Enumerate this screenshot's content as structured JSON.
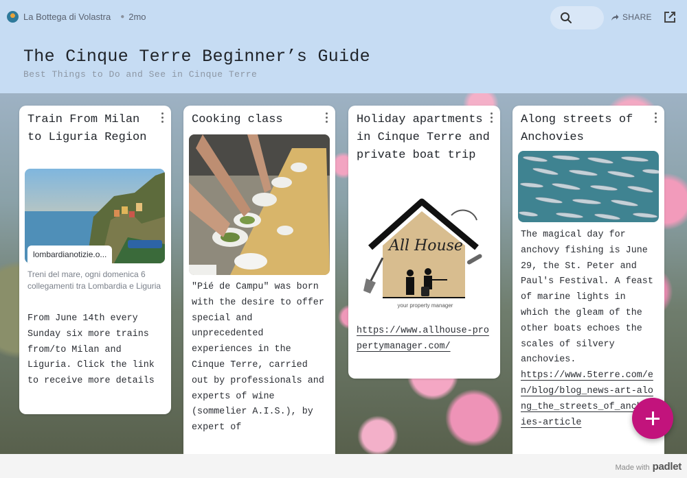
{
  "header": {
    "author": "La Bottega di Volastra",
    "age": "2mo",
    "share_label": "SHARE",
    "title": "The Cinque Terre Beginner’s Guide",
    "subtitle": "Best Things to Do and See in Cinque Terre"
  },
  "icons": {
    "search": "search-icon",
    "share": "share-arrow-icon",
    "open": "open-external-icon",
    "more": "kebab-icon",
    "add": "plus-icon"
  },
  "colors": {
    "header_bg": "#c6dcf3",
    "fab": "#c2137c"
  },
  "cards": [
    {
      "title": "Train From Milan to Liguria Region",
      "link_domain": "lombardianotizie.o...",
      "link_description": "Treni del mare, ogni domenica 6 collegamenti tra Lombardia e Liguria",
      "body": "From June 14th every Sunday six more trains from/to Milan and Liguria. Click the link to receive more details"
    },
    {
      "title": "Cooking class",
      "body": "\"Pié de Campu\" was born with the desire to offer special and unprecedented experiences in the Cinque Terre, carried out by professionals and experts of wine (sommelier A.I.S.), by expert of"
    },
    {
      "title": "Holiday apartments in Cinque Terre and private boat trip",
      "logo_text": "All House",
      "logo_tagline": "your property manager",
      "link": "https://www.allhouse-propertymanager.com/"
    },
    {
      "title": "Along streets of Anchovies",
      "body": "The magical day for anchovy fishing is June 29, the St. Peter and Paul's Festival. A feast of marine lights in which the gleam of the other boats echoes the scales of silvery anchovies.",
      "link": "https://www.5terre.com/en/blog/blog_news-art-along_the_streets_of_anchovies-article"
    }
  ],
  "footer": {
    "made_with": "Made with",
    "brand": "padlet"
  }
}
